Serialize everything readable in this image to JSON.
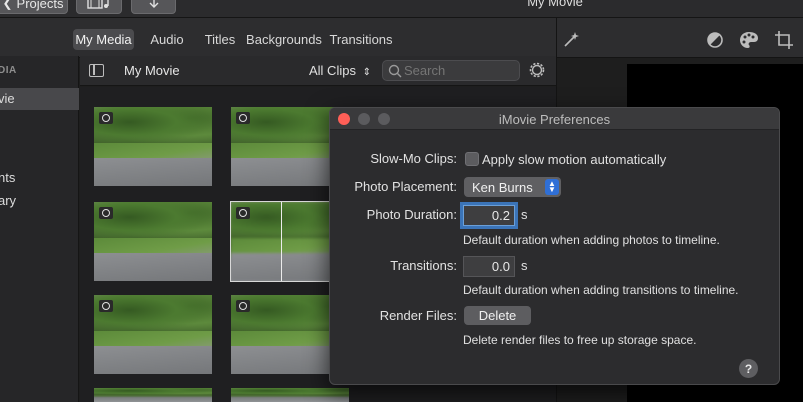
{
  "top_toolbar": {
    "projects_label": "Projects",
    "window_title": "My Movie"
  },
  "tabs": [
    "My Media",
    "Audio",
    "Titles",
    "Backgrounds",
    "Transitions"
  ],
  "active_tab": "My Media",
  "sidebar": {
    "header": "DIA",
    "items": [
      {
        "label": "vie",
        "selected": true
      },
      {
        "label": "nts",
        "selected": false
      },
      {
        "label": "ary",
        "selected": false
      }
    ]
  },
  "browser": {
    "title": "My Movie",
    "filter": "All Clips",
    "search_placeholder": "Search"
  },
  "thumbnails": [
    {
      "type": "photo",
      "selected": false
    },
    {
      "type": "photo",
      "selected": false
    },
    {
      "type": "photo",
      "selected": false
    },
    {
      "type": "photo",
      "selected": true
    },
    {
      "type": "photo",
      "selected": false
    },
    {
      "type": "photo",
      "selected": false
    }
  ],
  "preferences": {
    "title": "iMovie Preferences",
    "slowmo_label": "Slow-Mo Clips:",
    "slowmo_checkbox_label": "Apply slow motion automatically",
    "slowmo_checked": false,
    "photo_placement_label": "Photo Placement:",
    "photo_placement_value": "Ken Burns",
    "photo_duration_label": "Photo Duration:",
    "photo_duration_value": "0.2",
    "photo_duration_unit": "s",
    "photo_duration_hint": "Default duration when adding photos to timeline.",
    "transitions_label": "Transitions:",
    "transitions_value": "0.0",
    "transitions_unit": "s",
    "transitions_hint": "Default duration when adding transitions to timeline.",
    "render_files_label": "Render Files:",
    "delete_label": "Delete",
    "render_hint": "Delete render files to free up storage space.",
    "help_label": "?"
  },
  "colors": {
    "close": "#ff5f57",
    "minimize": "#5b5b5e",
    "zoom": "#5b5b5e",
    "accent": "#2f6fd6"
  },
  "icons": [
    "chevron-left-icon",
    "film-music-icon",
    "download-arrow-icon",
    "magic-wand-icon",
    "color-balance-icon",
    "palette-icon",
    "crop-icon",
    "sidebar-toggle-icon",
    "search-icon",
    "gear-icon",
    "camera-icon"
  ]
}
